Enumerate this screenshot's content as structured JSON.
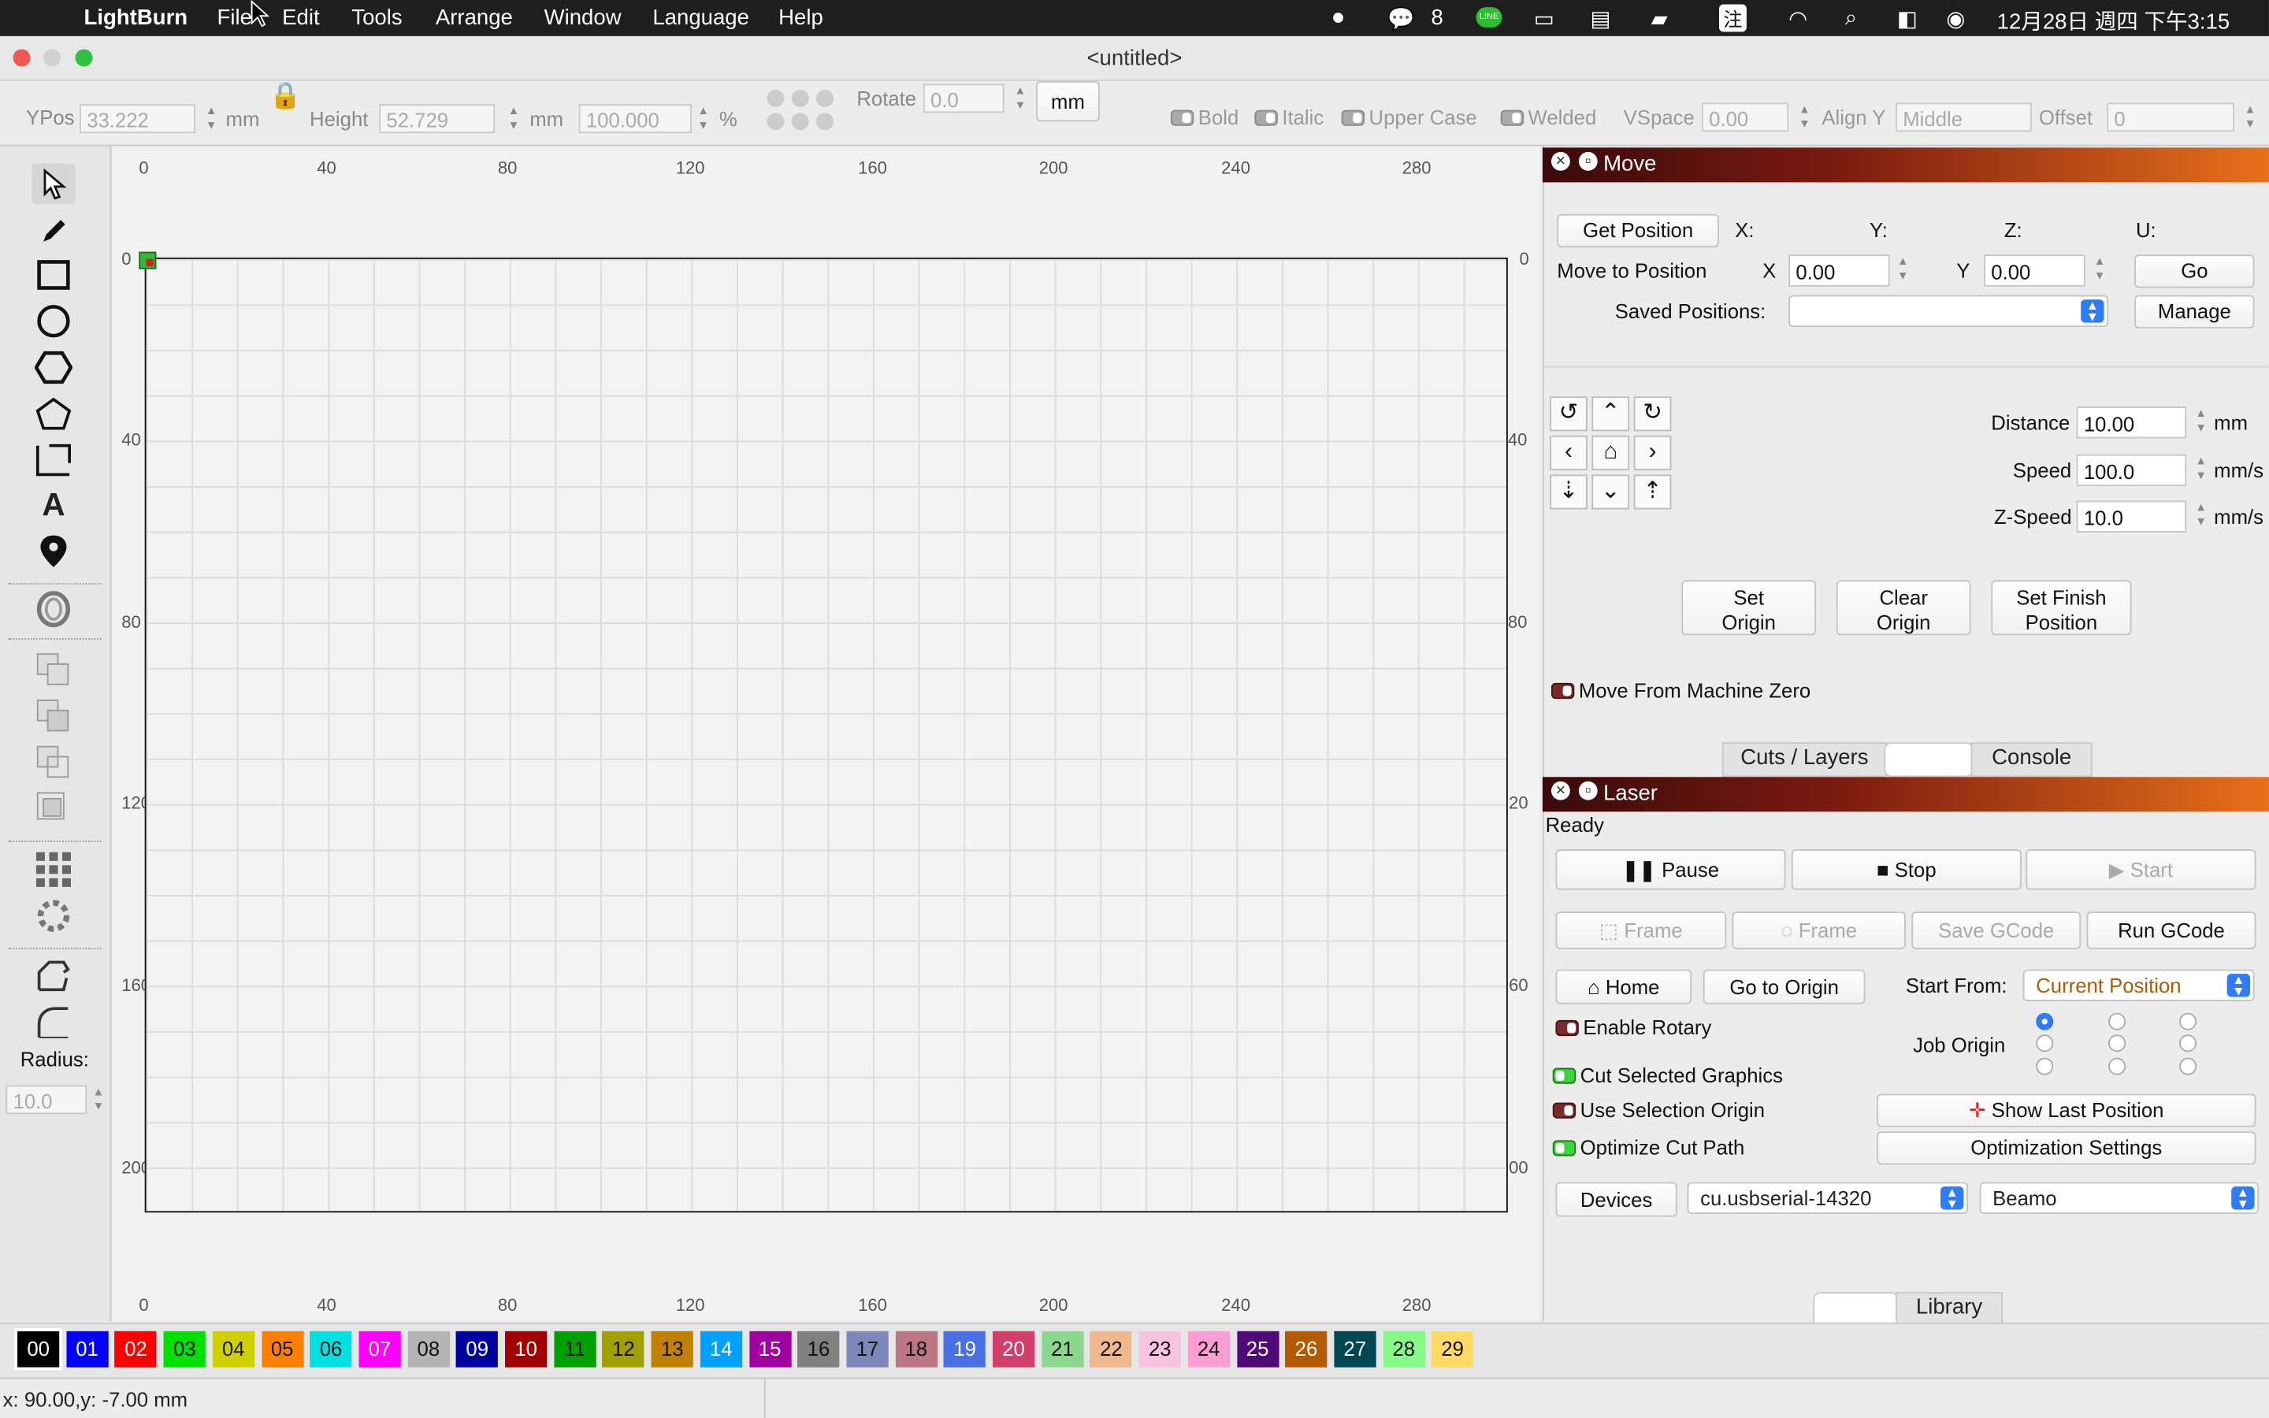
{
  "menubar": {
    "app": "LightBurn",
    "items": [
      "File",
      "Edit",
      "Tools",
      "Arrange",
      "Window",
      "Language",
      "Help"
    ],
    "wechat_count": "8",
    "line_label": "LINE",
    "input_method": "注",
    "clock": "12月28日 週四 下午3:15"
  },
  "window": {
    "title": "<untitled>"
  },
  "toolbar": {
    "ypos_label": "YPos",
    "ypos_value": "33.222",
    "unit_mm": "mm",
    "height_label": "Height",
    "height_value": "52.729",
    "height_pct": "100.000",
    "pct": "%",
    "rotate_label": "Rotate",
    "rotate_value": "0.0",
    "rotate_unit": "mm",
    "bold": "Bold",
    "italic": "Italic",
    "upper_case": "Upper Case",
    "welded": "Welded",
    "vspace_label": "VSpace",
    "vspace_value": "0.00",
    "align_y_label": "Align Y",
    "align_y_value": "Middle",
    "offset_label": "Offset",
    "offset_value": "0"
  },
  "tools": {
    "radius_label": "Radius:",
    "radius_value": "10.0"
  },
  "rulers": {
    "x_labels": [
      "0",
      "40",
      "80",
      "120",
      "160",
      "200",
      "240",
      "280"
    ],
    "y_labels": [
      "0",
      "40",
      "80",
      "120",
      "160",
      "200"
    ]
  },
  "move_panel": {
    "title": "Move",
    "get_position": "Get Position",
    "x_col": "X:",
    "y_col": "Y:",
    "z_col": "Z:",
    "u_col": "U:",
    "move_to_position": "Move to Position",
    "x_label": "X",
    "x_value": "0.00",
    "y_label": "Y",
    "y_value": "0.00",
    "go": "Go",
    "saved_positions": "Saved Positions:",
    "manage": "Manage",
    "distance_label": "Distance",
    "distance_value": "10.00",
    "distance_unit": "mm",
    "speed_label": "Speed",
    "speed_value": "100.0",
    "speed_unit": "mm/s",
    "zspeed_label": "Z-Speed",
    "zspeed_value": "10.0",
    "zspeed_unit": "mm/s",
    "set_origin": [
      "Set",
      "Origin"
    ],
    "clear_origin": [
      "Clear",
      "Origin"
    ],
    "set_finish": [
      "Set Finish",
      "Position"
    ],
    "move_from_machine_zero": "Move From Machine Zero"
  },
  "tabs_top": [
    "Cuts / Layers",
    "",
    "Console"
  ],
  "laser_panel": {
    "title": "Laser",
    "status": "Ready",
    "pause": "Pause",
    "stop": "Stop",
    "start": "Start",
    "frame1": "Frame",
    "frame2": "Frame",
    "save_gcode": "Save GCode",
    "run_gcode": "Run GCode",
    "home": "Home",
    "go_to_origin": "Go to Origin",
    "start_from_label": "Start From:",
    "start_from_value": "Current Position",
    "enable_rotary": "Enable Rotary",
    "job_origin": "Job Origin",
    "cut_selected": "Cut Selected Graphics",
    "use_selection_origin": "Use Selection Origin",
    "show_last_position": "Show Last Position",
    "optimize_cut_path": "Optimize Cut Path",
    "optimization_settings": "Optimization Settings",
    "devices": "Devices",
    "port": "cu.usbserial-14320",
    "device": "Beamo"
  },
  "tabs_bottom": [
    "",
    "Library"
  ],
  "palette": [
    {
      "n": "00",
      "c": "#000000",
      "t": "#ffffff"
    },
    {
      "n": "01",
      "c": "#0000ff",
      "t": "#ffffff"
    },
    {
      "n": "02",
      "c": "#ff0000",
      "t": "#ffffff"
    },
    {
      "n": "03",
      "c": "#00e000",
      "t": "#111111"
    },
    {
      "n": "04",
      "c": "#d0d000",
      "t": "#111111"
    },
    {
      "n": "05",
      "c": "#ff8000",
      "t": "#111111"
    },
    {
      "n": "06",
      "c": "#00e0e0",
      "t": "#111111"
    },
    {
      "n": "07",
      "c": "#ff00ff",
      "t": "#ffffff"
    },
    {
      "n": "08",
      "c": "#b4b4b4",
      "t": "#111111"
    },
    {
      "n": "09",
      "c": "#0000a0",
      "t": "#ffffff"
    },
    {
      "n": "10",
      "c": "#a00000",
      "t": "#ffffff"
    },
    {
      "n": "11",
      "c": "#00a000",
      "t": "#111111"
    },
    {
      "n": "12",
      "c": "#a0a000",
      "t": "#111111"
    },
    {
      "n": "13",
      "c": "#c08000",
      "t": "#111111"
    },
    {
      "n": "14",
      "c": "#00a0ff",
      "t": "#ffffff"
    },
    {
      "n": "15",
      "c": "#a000a0",
      "t": "#ffffff"
    },
    {
      "n": "16",
      "c": "#808080",
      "t": "#111111"
    },
    {
      "n": "17",
      "c": "#7d87b9",
      "t": "#111111"
    },
    {
      "n": "18",
      "c": "#bb7784",
      "t": "#111111"
    },
    {
      "n": "19",
      "c": "#4a6fe3",
      "t": "#ffffff"
    },
    {
      "n": "20",
      "c": "#d33f6a",
      "t": "#ffffff"
    },
    {
      "n": "21",
      "c": "#8cd78f",
      "t": "#111111"
    },
    {
      "n": "22",
      "c": "#f0b98d",
      "t": "#111111"
    },
    {
      "n": "23",
      "c": "#f6c4e1",
      "t": "#111111"
    },
    {
      "n": "24",
      "c": "#fa9ed4",
      "t": "#111111"
    },
    {
      "n": "25",
      "c": "#500a78",
      "t": "#ffffff"
    },
    {
      "n": "26",
      "c": "#b45a00",
      "t": "#ffffff"
    },
    {
      "n": "27",
      "c": "#004754",
      "t": "#ffffff"
    },
    {
      "n": "28",
      "c": "#86fa88",
      "t": "#111111"
    },
    {
      "n": "29",
      "c": "#ffdb66",
      "t": "#111111"
    }
  ],
  "status_bar": {
    "coords": "x: 90.00,y: -7.00 mm"
  }
}
